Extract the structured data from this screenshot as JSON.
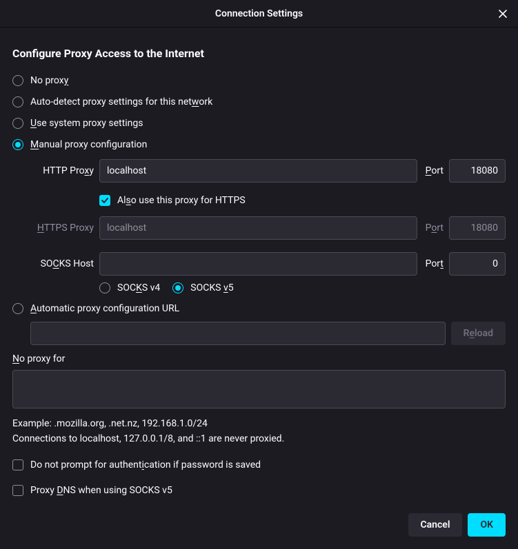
{
  "title": "Connection Settings",
  "heading": "Configure Proxy Access to the Internet",
  "modes": {
    "none": {
      "pre": "No prox",
      "u": "y",
      "post": ""
    },
    "auto": {
      "pre": "Auto-detect proxy settings for this net",
      "u": "w",
      "post": "ork"
    },
    "system": {
      "pre": "",
      "u": "U",
      "post": "se system proxy settings"
    },
    "manual": {
      "pre": "",
      "u": "M",
      "post": "anual proxy configuration"
    },
    "pac": {
      "pre": "",
      "u": "A",
      "post": "utomatic proxy configuration URL"
    }
  },
  "http": {
    "label_pre": "HTTP Pro",
    "label_u": "x",
    "label_post": "y",
    "host": "localhost",
    "port_u": "P",
    "port_post": "ort",
    "port": "18080"
  },
  "also": {
    "pre": "Al",
    "u": "s",
    "post": "o use this proxy for HTTPS",
    "checked": true
  },
  "https": {
    "label_u": "H",
    "label_post": "TTPS Proxy",
    "host": "localhost",
    "port_pre": "P",
    "port_u": "o",
    "port_post": "rt",
    "port": "18080"
  },
  "socks": {
    "label_pre": "SO",
    "label_u": "C",
    "label_post": "KS Host",
    "host": "",
    "port_pre": "Por",
    "port_u": "t",
    "port": "0"
  },
  "socks_v4": {
    "pre": "SOC",
    "u": "K",
    "post": "S v4"
  },
  "socks_v5": {
    "pre": "SOCKS ",
    "u": "v",
    "post": "5"
  },
  "pac": {
    "url": "",
    "reload_pre": "R",
    "reload_u": "e",
    "reload_post": "load"
  },
  "noproxy": {
    "label_u": "N",
    "label_post": "o proxy for",
    "value": ""
  },
  "example": "Example: .mozilla.org, .net.nz, 192.168.1.0/24",
  "localhost_note": "Connections to localhost, 127.0.0.1/8, and ::1 are never proxied.",
  "no_prompt": {
    "pre": "Do not prompt for authent",
    "u": "i",
    "post": "cation if password is saved",
    "checked": false
  },
  "proxy_dns": {
    "pre": "Proxy ",
    "u": "D",
    "post": "NS when using SOCKS v5",
    "checked": false
  },
  "buttons": {
    "cancel": "Cancel",
    "ok": "OK"
  }
}
